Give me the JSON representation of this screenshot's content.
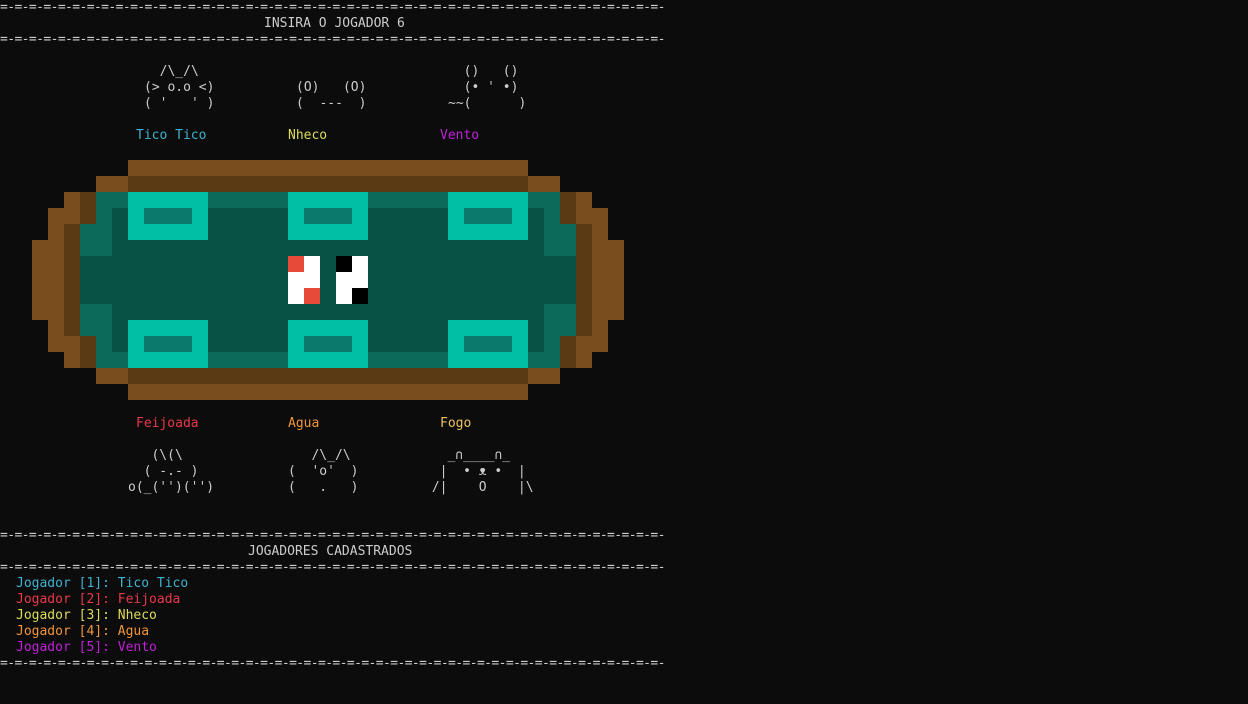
{
  "header": {
    "rule": "=-=-=-=-=-=-=-=-=-=-=-=-=-=-=-=-=-=-=-=-=-=-=-=-=-=-=-=-=-=-=-=-=-=-=-=-=-=-=-=-=-=-=-=-=-=-=-=-=-=-=-=-=-=-=-=-=-=-=-=-=-=-=-=-=-=-",
    "title": "INSIRA O JOGADOR 6"
  },
  "top_players": [
    {
      "name": "Tico Tico",
      "color": "#3fb3d0",
      "art": [
        "  /\\_/\\",
        "(> o.o <)",
        "( '   ' )"
      ]
    },
    {
      "name": "Nheco",
      "color": "#dcdc5a",
      "art": [
        "",
        "(O)   (O)",
        "(  ---  )"
      ]
    },
    {
      "name": "Vento",
      "color": "#c020d8",
      "art": [
        "  ()   ()",
        "  (• ' •)",
        "~~(      )"
      ]
    }
  ],
  "bottom_players": [
    {
      "name": "Feijoada",
      "color": "#e8394a",
      "art": [
        "   (\\(\\",
        "  ( -.- )",
        "o(_('')('')"
      ]
    },
    {
      "name": "Agua",
      "color": "#f0943a",
      "art": [
        "   /\\_/\\",
        "(  'o'  )",
        "(   .   )"
      ]
    },
    {
      "name": "Fogo",
      "color": "#f0c060",
      "art": [
        "   _∩____∩_",
        "  |  • ᴥ •  |",
        " /|    O    |\\"
      ]
    }
  ],
  "registered": {
    "title": "JOGADORES CADASTRADOS",
    "items": [
      {
        "label": "Jogador [1]: Tico Tico",
        "color": "#3fb3d0"
      },
      {
        "label": "Jogador [2]: Feijoada",
        "color": "#e8394a"
      },
      {
        "label": "Jogador [3]: Nheco",
        "color": "#dcdc5a"
      },
      {
        "label": "Jogador [4]: Agua",
        "color": "#f0943a"
      },
      {
        "label": "Jogador [5]: Vento",
        "color": "#c020d8"
      }
    ]
  },
  "dice": [
    {
      "icon": "die-face-2-red",
      "pip_color": "#e84a3a"
    },
    {
      "icon": "die-face-2-black",
      "pip_color": "#000000"
    }
  ],
  "colors": {
    "background": "#0c0c0c",
    "text": "#cccccc",
    "table_felt": "#075244",
    "table_felt_edge": "#0b6a5a",
    "table_wood": "#7a4e1c",
    "table_wood_dark": "#5a3a14",
    "seat": "#00bfa5",
    "seat_inner": "#0b7a6c"
  }
}
